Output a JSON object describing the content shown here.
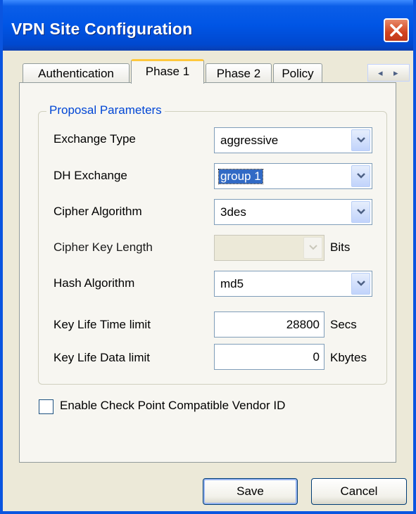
{
  "window": {
    "title": "VPN Site Configuration"
  },
  "tabs": [
    {
      "label": "Authentication",
      "active": false
    },
    {
      "label": "Phase 1",
      "active": true
    },
    {
      "label": "Phase 2",
      "active": false
    },
    {
      "label": "Policy",
      "active": false
    }
  ],
  "tab_scroll": {
    "left": "◂",
    "right": "▸"
  },
  "group": {
    "label": "Proposal Parameters",
    "fields": {
      "exchange_type": {
        "label": "Exchange Type",
        "value": "aggressive"
      },
      "dh_exchange": {
        "label": "DH Exchange",
        "value": "group 1"
      },
      "cipher_algorithm": {
        "label": "Cipher Algorithm",
        "value": "3des"
      },
      "cipher_key_length": {
        "label": "Cipher Key Length",
        "value": "",
        "unit": "Bits",
        "disabled": true
      },
      "hash_algorithm": {
        "label": "Hash Algorithm",
        "value": "md5"
      },
      "key_life_time": {
        "label": "Key Life Time limit",
        "value": "28800",
        "unit": "Secs"
      },
      "key_life_data": {
        "label": "Key Life Data limit",
        "value": "0",
        "unit": "Kbytes"
      }
    }
  },
  "vendor_id": {
    "label": "Enable Check Point Compatible Vendor ID",
    "checked": false
  },
  "buttons": {
    "save": "Save",
    "cancel": "Cancel"
  },
  "colors": {
    "titlebar": "#0055e5",
    "group_label": "#0046d5",
    "tab_highlight": "#ffc83c",
    "selection": "#316ac5"
  }
}
